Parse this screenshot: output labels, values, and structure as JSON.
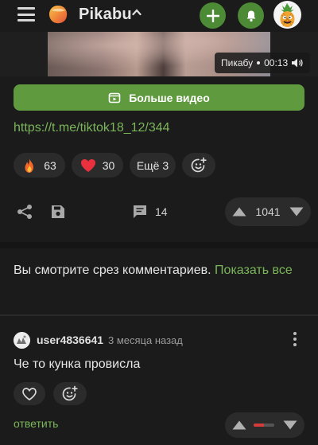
{
  "header": {
    "brand": "Pikabu",
    "menu_icon": "hamburger-icon",
    "add_icon": "plus-icon",
    "notifications_icon": "bell-icon",
    "accent": "#4c8a35"
  },
  "video": {
    "source": "Пикабу",
    "duration": "00:13",
    "sound_icon": "speaker-icon"
  },
  "more_video": {
    "label": "Больше видео",
    "icon": "video-library-icon"
  },
  "link": "https://t.me/tiktok18_12/344",
  "reactions": [
    {
      "icon": "fire-emoji",
      "count": "63"
    },
    {
      "icon": "heart-emoji",
      "count": "30"
    }
  ],
  "reactions_more": "Ещё 3",
  "actions": {
    "comments_count": "14",
    "rating": "1041"
  },
  "notice": {
    "text": "Вы смотрите срез комментариев.",
    "link": "Показать все"
  },
  "comment": {
    "user": "user4836641",
    "time": "3 месяца назад",
    "text": "Че то кунка провисла",
    "reply": "ответить",
    "rating_negative_fraction": 0.5
  },
  "colors": {
    "green": "#5f9a3e",
    "link_green": "#7bb65a",
    "background": "#1b1b1b",
    "negative": "#d63b3b"
  }
}
